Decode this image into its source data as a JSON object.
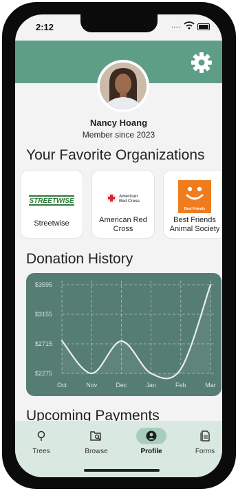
{
  "status_bar": {
    "time": "2:12"
  },
  "profile": {
    "name": "Nancy Hoang",
    "member_since": "Member since 2023"
  },
  "favorites": {
    "heading": "Your Favorite Organizations",
    "items": [
      {
        "label": "Streetwise",
        "logo_text": "STREETWISE"
      },
      {
        "label": "American Red Cross",
        "logo_text": "American Red Cross"
      },
      {
        "label": "Best Friends Animal Society",
        "logo_text": "Best Friends"
      }
    ]
  },
  "donation_history": {
    "heading": "Donation History"
  },
  "chart_data": {
    "type": "line",
    "categories": [
      "Oct",
      "Nov",
      "Dec",
      "Jan",
      "Feb",
      "Mar"
    ],
    "y_ticks": [
      "$3595",
      "$3155",
      "$2715",
      "$2275"
    ],
    "ylim": [
      2275,
      3595
    ],
    "grid": true,
    "series": [
      {
        "values": [
          2760,
          2275,
          2755,
          2275,
          2340,
          3595
        ]
      }
    ]
  },
  "upcoming": {
    "heading": "Upcoming Payments"
  },
  "tabs": [
    {
      "label": "Trees",
      "icon": "sprout-icon",
      "active": false
    },
    {
      "label": "Browse",
      "icon": "browse-icon",
      "active": false
    },
    {
      "label": "Profile",
      "icon": "person-icon",
      "active": true
    },
    {
      "label": "Forms",
      "icon": "document-icon",
      "active": false
    }
  ],
  "colors": {
    "header": "#5f9e86",
    "chart_bg": "#567d73",
    "tabbar": "#d9e9e2",
    "active_pill": "#a8cdbd",
    "line": "#e8eeeb"
  }
}
